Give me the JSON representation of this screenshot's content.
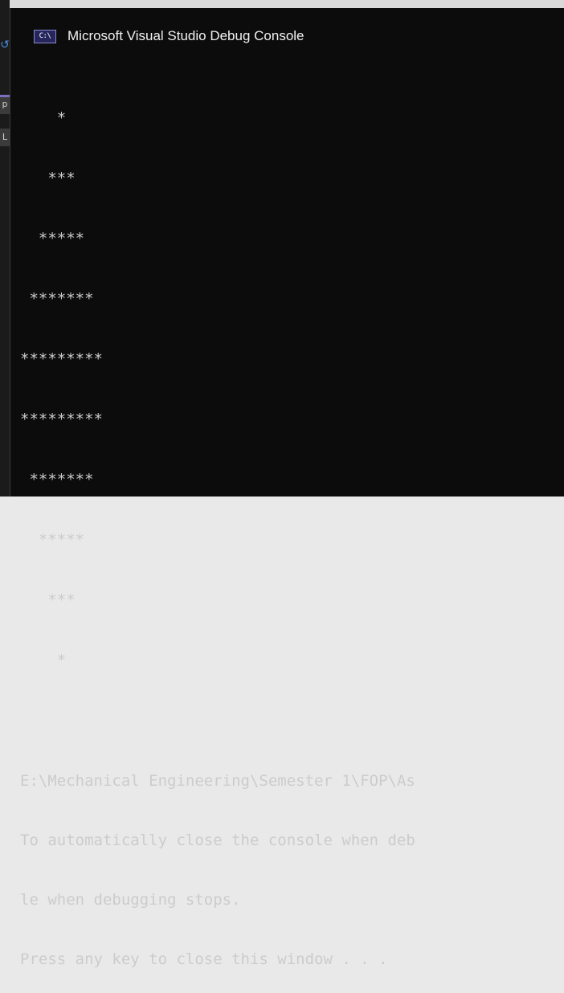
{
  "window": {
    "icon_label": "C:\\",
    "title": "Microsoft Visual Studio Debug Console"
  },
  "background": {
    "marker_p": "p",
    "marker_l": "L"
  },
  "output": {
    "pattern": [
      "    *",
      "   ***",
      "  *****",
      " *******",
      "*********",
      "*********",
      " *******",
      "  *****",
      "   ***",
      "    *"
    ],
    "messages": [
      "E:\\Mechanical Engineering\\Semester 1\\FOP\\As",
      "To automatically close the console when deb",
      "le when debugging stops.",
      "Press any key to close this window . . ."
    ]
  }
}
